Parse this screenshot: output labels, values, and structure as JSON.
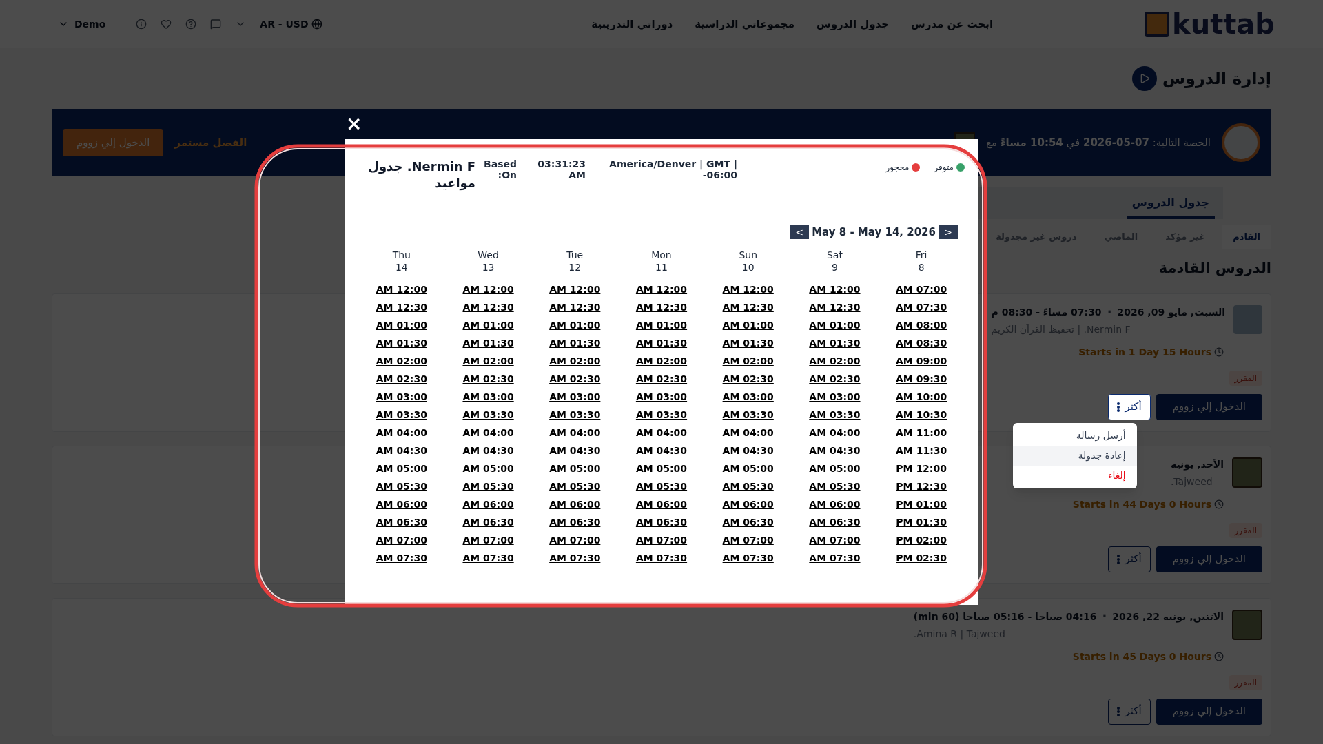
{
  "header": {
    "logo": "kuttab",
    "nav": [
      "ابحث عن مدرس",
      "جدول الدروس",
      "مجموعاتي الدراسية",
      "دوراتي التدريبية"
    ],
    "currency": "AR - USD",
    "user": "Demo"
  },
  "page_title": "إدارة الدروس",
  "banner": {
    "next_class": "الحصة التالية: **07-05-2026** في **10:54 مساءً** مع",
    "status": "الفصل مستمر",
    "button": "الدخول إلي زووم"
  },
  "tabs": [
    {
      "label": "جدول الدروس",
      "selected": true
    }
  ],
  "subtabs": [
    {
      "label": "القادم",
      "selected": true
    },
    {
      "label": "غير مؤكد",
      "selected": false
    },
    {
      "label": "الماضي",
      "selected": false
    },
    {
      "label": "دروس غير مجدولة",
      "selected": false
    }
  ],
  "section_title": "الدروس القادمة",
  "lessons": [
    {
      "kind": "person",
      "date": "السبت, مايو 09, 2026",
      "separator": "·",
      "time": "07:30 مساءً - 08:30 م",
      "subtitle": "Nermin F. | تحفيظ القرآن الكريم",
      "countdown": "Starts in 1 Day 15 Hours",
      "badge": "المقرر",
      "zoom_button": "الدخول إلي زووم",
      "more_button": "أكثر",
      "menu_open": true
    },
    {
      "kind": "book",
      "date": "الأحد, يونيه",
      "subtitle": "Tajweed.",
      "countdown": "Starts in 44 Days 0 Hours",
      "badge": "المقرر",
      "zoom_button": "الدخول إلي زووم",
      "more_button": "أكثر",
      "menu_open": false
    },
    {
      "kind": "book",
      "date": "الاثنين, يونيه 22, 2026",
      "separator": "·",
      "time": "04:16 صباحا - 05:16 صباحا (60 min)",
      "subtitle": "Amina R | Tajweed.",
      "countdown": "Starts in 45 Days 0 Hours",
      "badge": "المقرر",
      "zoom_button": "الدخول إلي زووم",
      "more_button": "أكثر",
      "menu_open": false
    }
  ],
  "more_menu": [
    {
      "label": "أرسل رسالة",
      "kind": "normal",
      "selected": false
    },
    {
      "label": "إعادة جدولة",
      "kind": "normal",
      "selected": true
    },
    {
      "label": "إلغاء",
      "kind": "danger",
      "selected": false
    }
  ],
  "modal": {
    "close": "×",
    "title": "Nermin F. جدول مواعيد",
    "based_on": "Based On:",
    "time": "03:31:23 AM",
    "timezone": "America/Denver | GMT | -06:00",
    "legend": [
      {
        "label": "متوفر",
        "color": "#38a169"
      },
      {
        "label": "محجوز",
        "color": "#e53e3e"
      }
    ],
    "next": ">",
    "range": "May 8 - May 14, 2026",
    "prev": "<",
    "days": [
      {
        "name": "Thu",
        "date": "14",
        "slots": [
          "AM 12:00",
          "AM 12:30",
          "AM 01:00",
          "AM 01:30",
          "AM 02:00",
          "AM 02:30",
          "AM 03:00",
          "AM 03:30",
          "AM 04:00",
          "AM 04:30",
          "AM 05:00",
          "AM 05:30",
          "AM 06:00",
          "AM 06:30",
          "AM 07:00",
          "AM 07:30"
        ]
      },
      {
        "name": "Wed",
        "date": "13",
        "slots": [
          "AM 12:00",
          "AM 12:30",
          "AM 01:00",
          "AM 01:30",
          "AM 02:00",
          "AM 02:30",
          "AM 03:00",
          "AM 03:30",
          "AM 04:00",
          "AM 04:30",
          "AM 05:00",
          "AM 05:30",
          "AM 06:00",
          "AM 06:30",
          "AM 07:00",
          "AM 07:30"
        ]
      },
      {
        "name": "Tue",
        "date": "12",
        "slots": [
          "AM 12:00",
          "AM 12:30",
          "AM 01:00",
          "AM 01:30",
          "AM 02:00",
          "AM 02:30",
          "AM 03:00",
          "AM 03:30",
          "AM 04:00",
          "AM 04:30",
          "AM 05:00",
          "AM 05:30",
          "AM 06:00",
          "AM 06:30",
          "AM 07:00",
          "AM 07:30"
        ]
      },
      {
        "name": "Mon",
        "date": "11",
        "slots": [
          "AM 12:00",
          "AM 12:30",
          "AM 01:00",
          "AM 01:30",
          "AM 02:00",
          "AM 02:30",
          "AM 03:00",
          "AM 03:30",
          "AM 04:00",
          "AM 04:30",
          "AM 05:00",
          "AM 05:30",
          "AM 06:00",
          "AM 06:30",
          "AM 07:00",
          "AM 07:30"
        ]
      },
      {
        "name": "Sun",
        "date": "10",
        "slots": [
          "AM 12:00",
          "AM 12:30",
          "AM 01:00",
          "AM 01:30",
          "AM 02:00",
          "AM 02:30",
          "AM 03:00",
          "AM 03:30",
          "AM 04:00",
          "AM 04:30",
          "AM 05:00",
          "AM 05:30",
          "AM 06:00",
          "AM 06:30",
          "AM 07:00",
          "AM 07:30"
        ]
      },
      {
        "name": "Sat",
        "date": "9",
        "slots": [
          "AM 12:00",
          "AM 12:30",
          "AM 01:00",
          "AM 01:30",
          "AM 02:00",
          "AM 02:30",
          "AM 03:00",
          "AM 03:30",
          "AM 04:00",
          "AM 04:30",
          "AM 05:00",
          "AM 05:30",
          "AM 06:00",
          "AM 06:30",
          "AM 07:00",
          "AM 07:30"
        ]
      },
      {
        "name": "Fri",
        "date": "8",
        "slots": [
          "AM 07:00",
          "AM 07:30",
          "AM 08:00",
          "AM 08:30",
          "AM 09:00",
          "AM 09:30",
          "AM 10:00",
          "AM 10:30",
          "AM 11:00",
          "AM 11:30",
          "PM 12:00",
          "PM 12:30",
          "PM 01:00",
          "PM 01:30",
          "PM 02:00",
          "PM 02:30"
        ]
      }
    ]
  }
}
